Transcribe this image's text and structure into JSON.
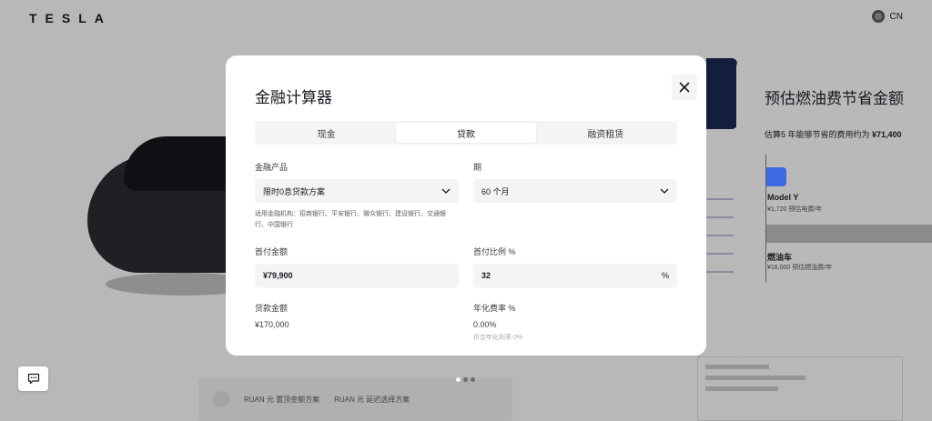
{
  "header": {
    "logo": "TESLA",
    "locale": "CN"
  },
  "background": {
    "bottom_card": {
      "item1": "RUAN 元 置顶金额方案",
      "item2": "RUAN 元 延迟选择方案"
    }
  },
  "modal": {
    "title": "金融计算器",
    "tabs": [
      "现金",
      "贷款",
      "融资租赁"
    ],
    "active_tab": "贷款",
    "finance_product": {
      "label": "金融产品",
      "value": "限时0息贷款方案",
      "note": "适用金融机构：招商银行、平安银行、微众银行、建设银行、交通银行、中国银行"
    },
    "term": {
      "label": "期",
      "value": "60 个月"
    },
    "down_payment": {
      "label": "首付金额",
      "value": "¥79,900"
    },
    "down_payment_ratio": {
      "label": "首付比例 %",
      "value": "32",
      "suffix": "%"
    },
    "loan_amount": {
      "label": "贷款金额",
      "value": "¥170,000"
    },
    "annual_rate": {
      "label": "年化费率 %",
      "value": "0.00%",
      "sub": "折合年化利率 0%"
    }
  },
  "savings": {
    "title": "预估燃油费节省金额",
    "desc_prefix": "估算5 年能够节省的费用约为",
    "desc_amount": "¥71,400",
    "model_y": {
      "label": "Model Y",
      "sub": "¥1,720 预估电费/年",
      "annual_cost": 1720
    },
    "gas_car": {
      "label": "燃油车",
      "sub": "¥16,000 预估燃油费/年",
      "annual_cost": 16000
    }
  },
  "carousel": {
    "active_index": 0,
    "count": 3
  },
  "colors": {
    "accent": "#3e6ae1",
    "text": "#171a20",
    "field_bg": "#f4f4f4"
  }
}
